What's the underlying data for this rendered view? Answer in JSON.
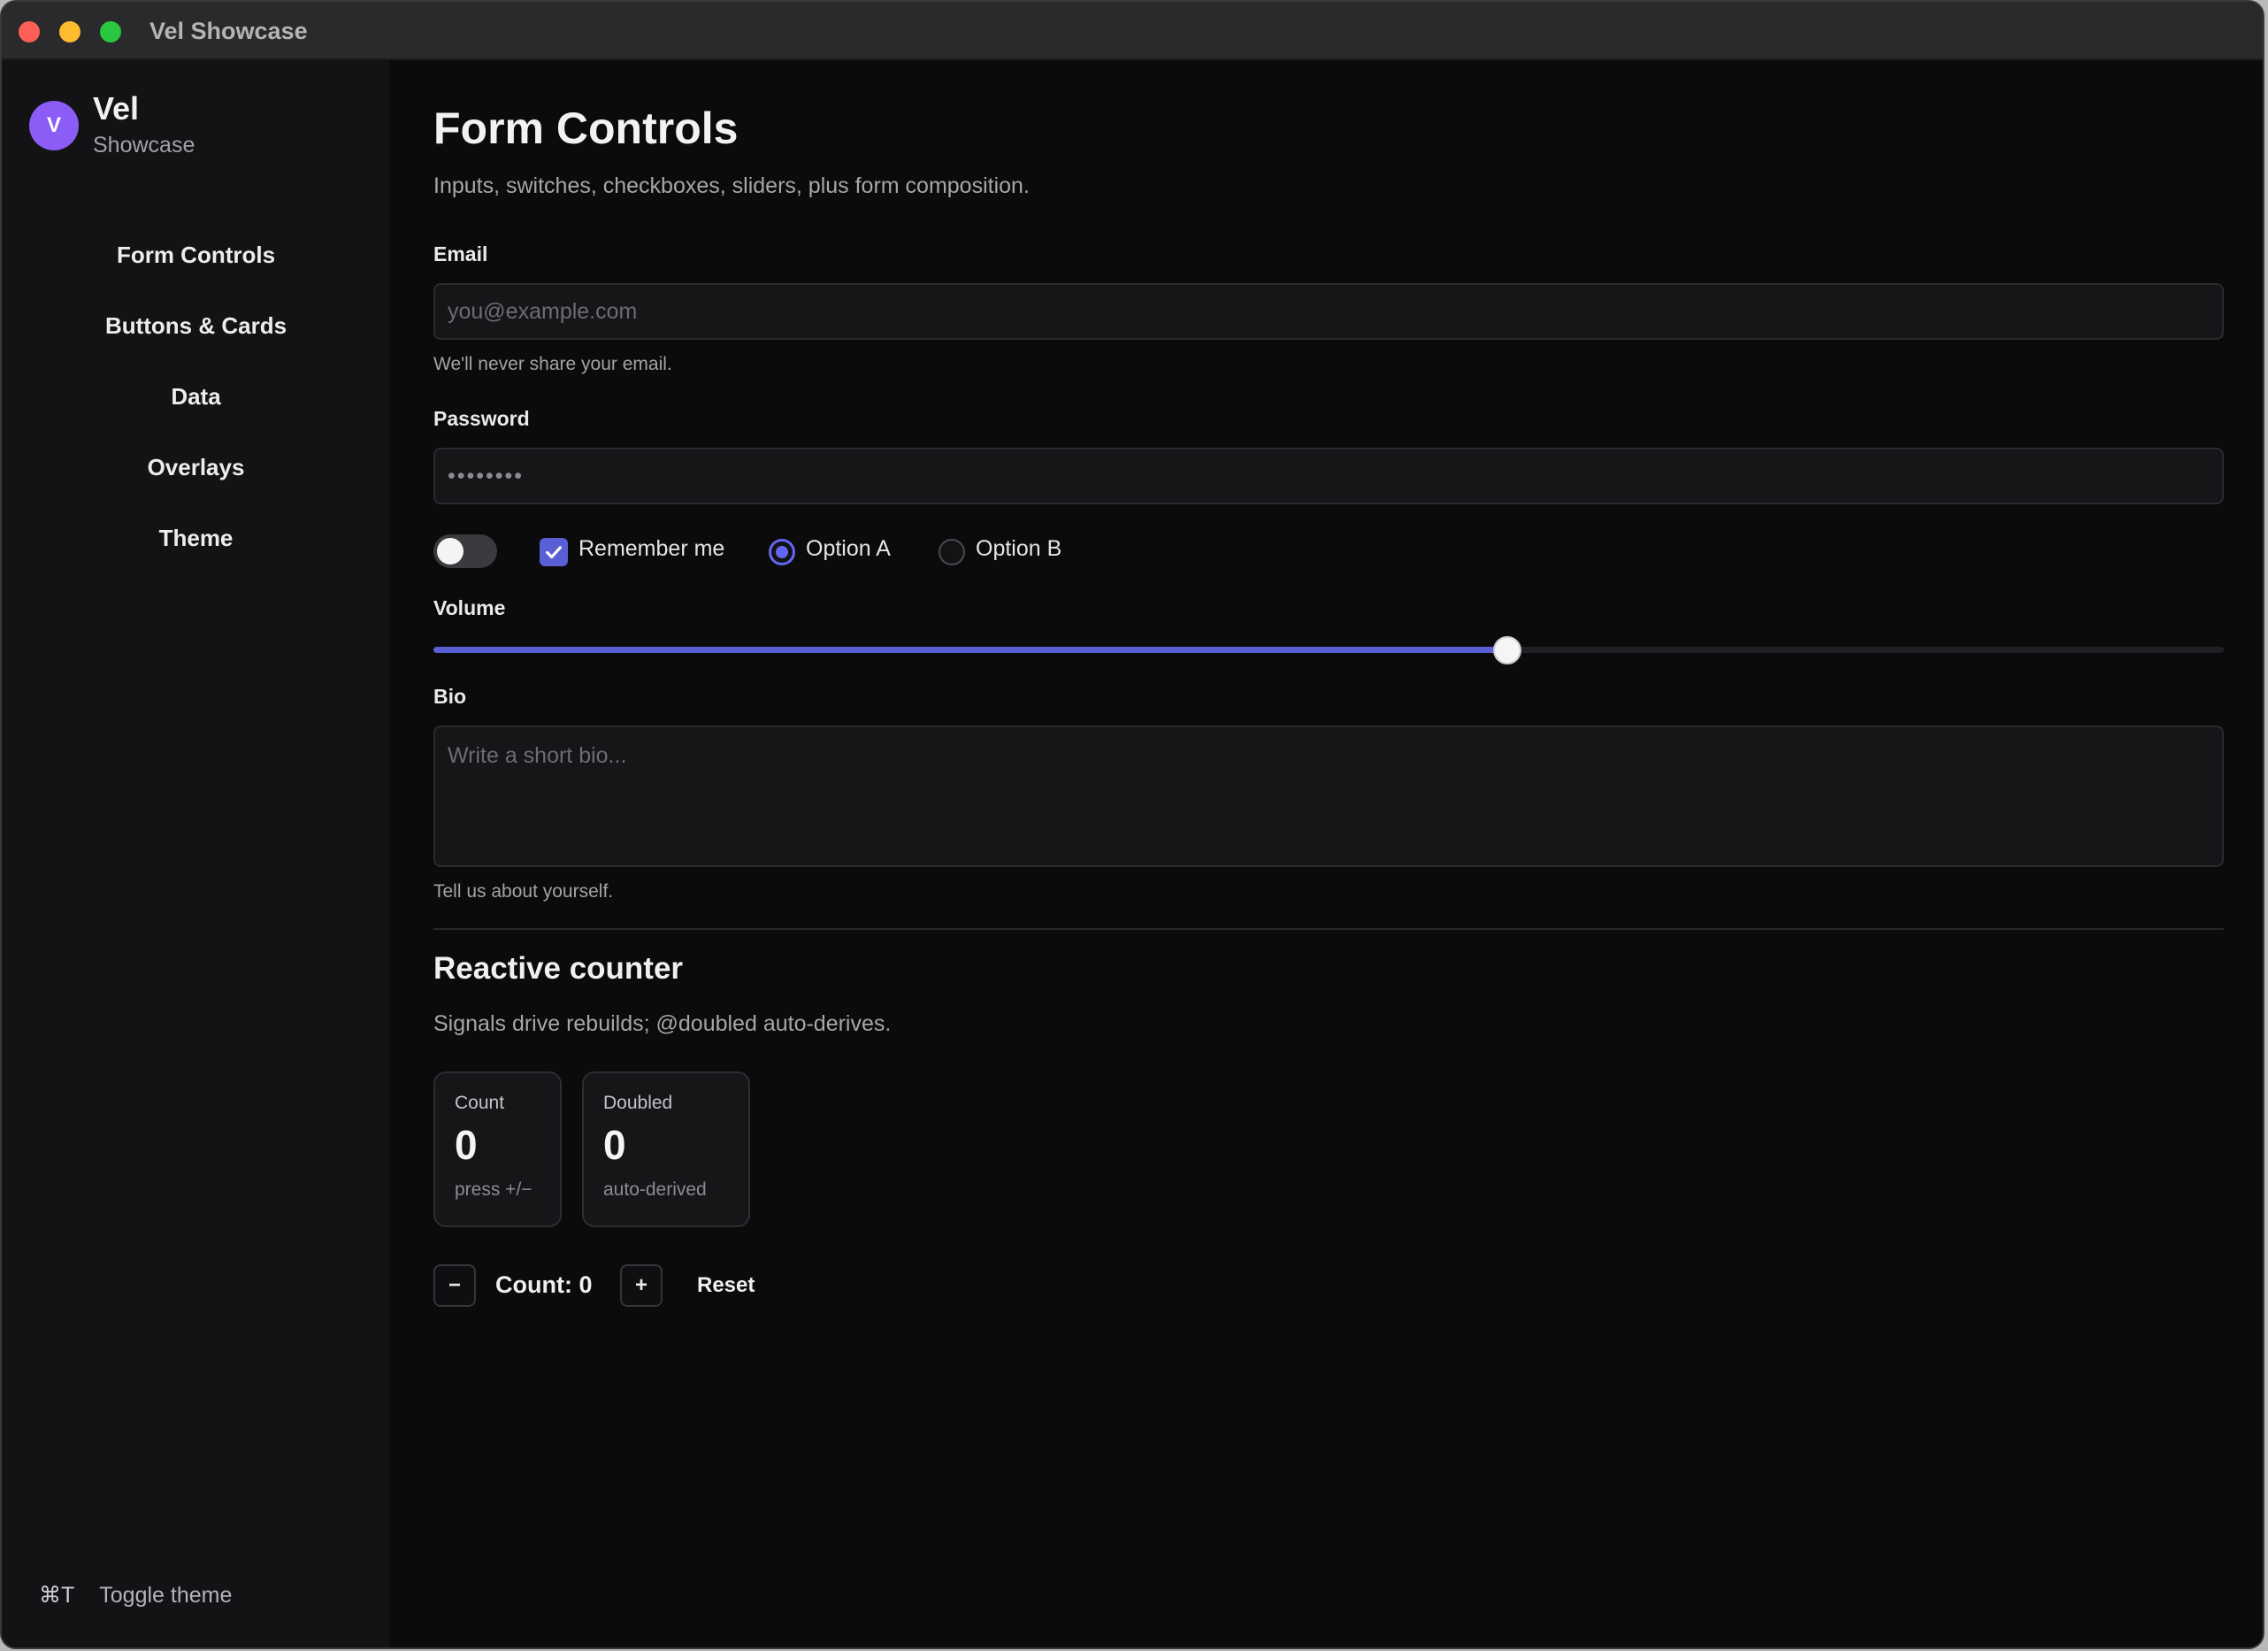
{
  "window": {
    "title": "Vel Showcase",
    "controls": [
      "close",
      "minimize",
      "zoom"
    ]
  },
  "sidebar": {
    "brand": {
      "avatar_letter": "V",
      "name": "Vel",
      "subtitle": "Showcase",
      "avatar_color": "#8b5cf6"
    },
    "items": [
      {
        "label": "Form Controls"
      },
      {
        "label": "Buttons & Cards"
      },
      {
        "label": "Data"
      },
      {
        "label": "Overlays"
      },
      {
        "label": "Theme"
      }
    ],
    "footer": {
      "shortcut": "⌘T",
      "label": "Toggle theme"
    }
  },
  "main": {
    "title": "Form Controls",
    "subtitle": "Inputs, switches, checkboxes, sliders, plus form composition.",
    "email": {
      "label": "Email",
      "placeholder": "you@example.com",
      "value": "",
      "help": "We'll never share your email."
    },
    "password": {
      "label": "Password",
      "value": "••••••••"
    },
    "toggle": {
      "on": false
    },
    "remember": {
      "label": "Remember me",
      "checked": true
    },
    "radios": [
      {
        "label": "Option A",
        "checked": true
      },
      {
        "label": "Option B",
        "checked": false
      }
    ],
    "volume": {
      "label": "Volume",
      "value": 0.6
    },
    "bio": {
      "label": "Bio",
      "placeholder": "Write a short bio...",
      "help": "Tell us about yourself."
    },
    "counter": {
      "title": "Reactive counter",
      "subtitle": "Signals drive rebuilds; @doubled auto-derives.",
      "cards": [
        {
          "label": "Count",
          "value": "0",
          "hint": "press +/−"
        },
        {
          "label": "Doubled",
          "value": "0",
          "hint": "auto-derived"
        }
      ],
      "minus_label": "−",
      "count_text": "Count: 0",
      "plus_label": "+",
      "reset_label": "Reset"
    }
  },
  "colors": {
    "accent": "#5b5fd6",
    "radio_accent": "#6366f1",
    "background": "#0b0b0c",
    "sidebar": "#131316"
  }
}
